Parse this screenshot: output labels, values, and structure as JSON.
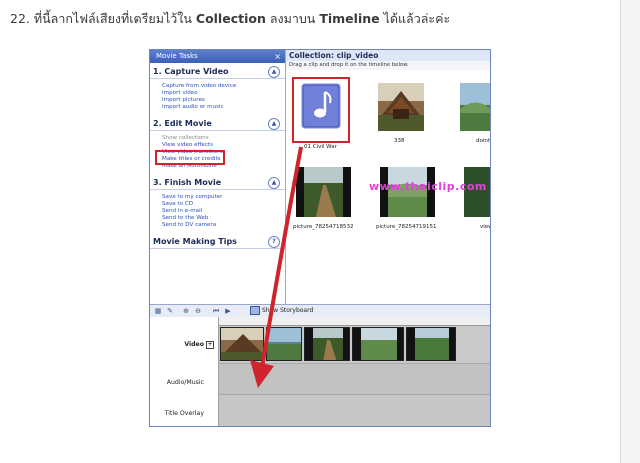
{
  "page": {
    "heading_num": "22.",
    "heading_t1": "ที่นี้ลากไฟล์เสียงที่เตรียมไว้ใน",
    "heading_b1": "Collection",
    "heading_t2": "ลงมาบน",
    "heading_b2": "Timeline",
    "heading_t3": "ได้แล้วล่ะค่ะ"
  },
  "tasks": {
    "title": "Movie Tasks",
    "close": "×",
    "sections": [
      {
        "title": "1. Capture Video",
        "arrow": "▲",
        "items": [
          "Capture from video device",
          "Import video",
          "Import pictures",
          "Import audio or music"
        ]
      },
      {
        "title": "2. Edit Movie",
        "arrow": "▲",
        "items": [
          "Show collections",
          "View video effects",
          "View video transitions",
          "Make titles or credits",
          "Make an AutoMovie"
        ]
      },
      {
        "title": "3. Finish Movie",
        "arrow": "▲",
        "items": [
          "Save to my computer",
          "Save to CD",
          "Send in e-mail",
          "Send to the Web",
          "Send to DV camera"
        ]
      },
      {
        "title": "Movie Making Tips",
        "arrow": "?"
      }
    ]
  },
  "collection": {
    "title": "Collection: clip_video",
    "subtitle": "Drag a clip and drop it on the timeline below.",
    "items": [
      "01 Civil War",
      "338",
      "dointhanon",
      "picture_78254718532",
      "picture_78254719151",
      "view"
    ],
    "watermark": "www.thaiclip.com"
  },
  "toolbar": {
    "storyboard_label": "Show Storyboard"
  },
  "timeline": {
    "video_label": "Video",
    "video_expand": "+",
    "audio_label": "Audio/Music",
    "title_label": "Title Overlay"
  },
  "colors": {
    "highlight": "#d0242c",
    "link": "#2a52b6",
    "watermark": "#e040d8"
  }
}
